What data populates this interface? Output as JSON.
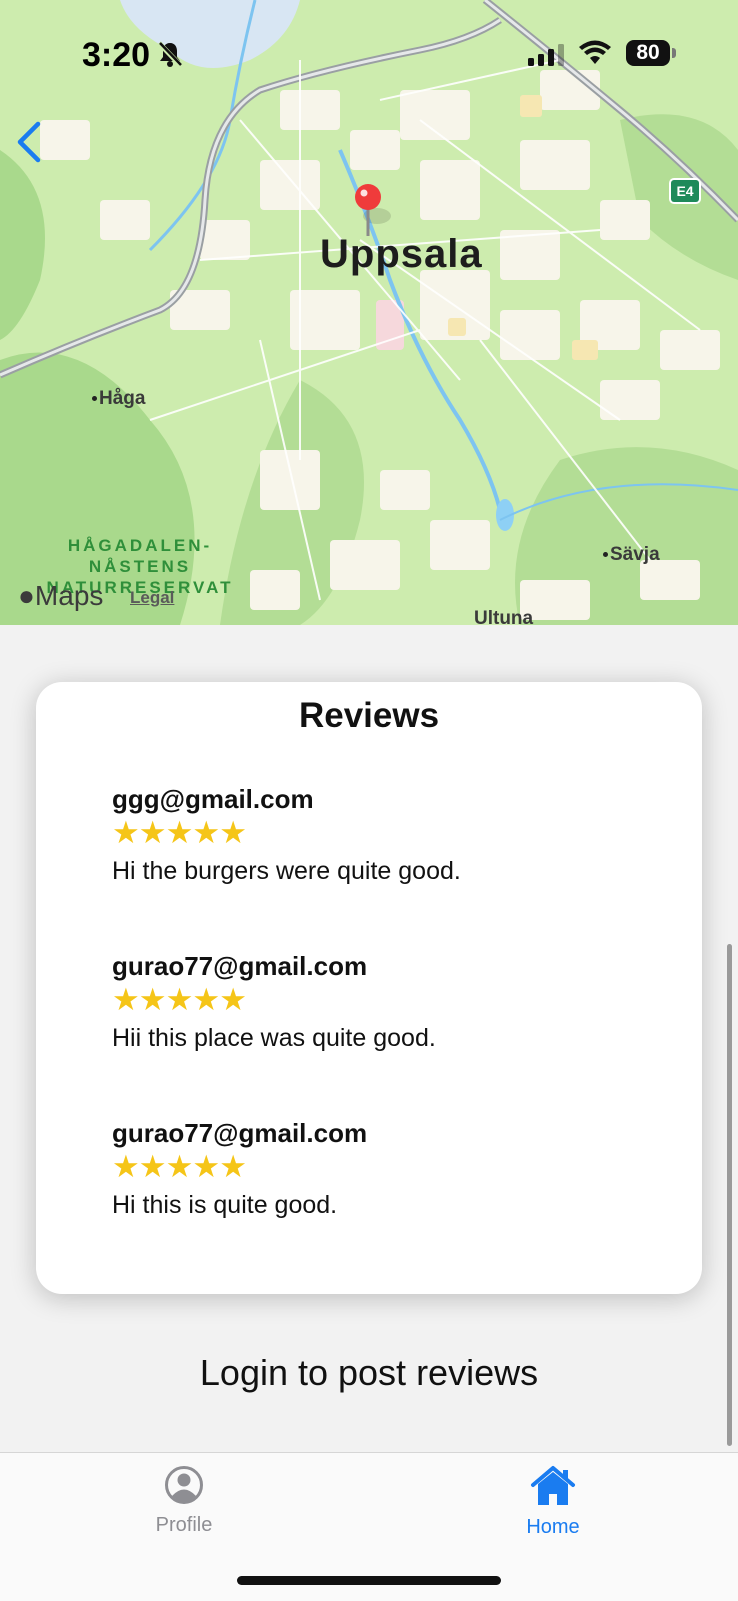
{
  "status_bar": {
    "time": "3:20",
    "battery": "80"
  },
  "map": {
    "city": "Uppsala",
    "places": [
      "Håga",
      "Sävja",
      "Ultuna"
    ],
    "reserve_label": "HÅGADALEN-\nNÅSTENS\nNATURRESERVAT",
    "road_shield": "E4",
    "brand": "Maps",
    "legal": "Legal"
  },
  "reviews": {
    "title": "Reviews",
    "items": [
      {
        "email": "ggg@gmail.com",
        "rating": 5,
        "text": "Hi the burgers were quite good."
      },
      {
        "email": "gurao77@gmail.com",
        "rating": 5,
        "text": "Hii this place was quite good."
      },
      {
        "email": "gurao77@gmail.com",
        "rating": 5,
        "text": "Hi this is quite good."
      }
    ]
  },
  "login_prompt": "Login to post reviews",
  "tabbar": {
    "profile": "Profile",
    "home": "Home",
    "active": "Home"
  },
  "colors": {
    "accent": "#1a7cf0",
    "star": "#f5c518",
    "map_green": "#cfeeb2"
  },
  "icons": [
    "bell-slash-icon",
    "back-chevron-icon",
    "map-pin-icon",
    "person-circle-icon",
    "house-icon"
  ]
}
